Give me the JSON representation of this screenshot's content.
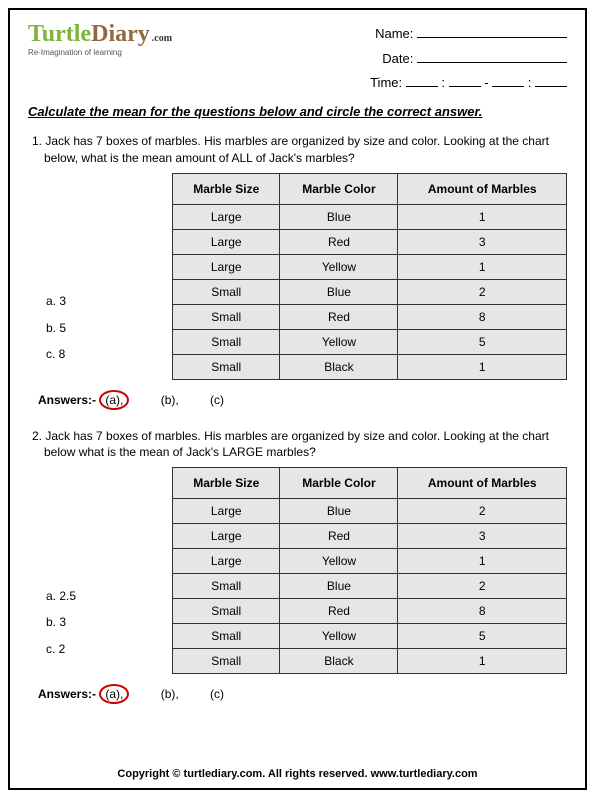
{
  "header": {
    "brand": "TurtleDiary",
    "dotcom": ".com",
    "tagline": "Re-Imagination of learning",
    "name_label": "Name:",
    "date_label": "Date:",
    "time_label": "Time:"
  },
  "instruction": "Calculate the mean for the questions below and circle the correct answer.",
  "q1": {
    "num": "1.",
    "text": "Jack has 7 boxes of marbles. His marbles are organized by size and color. Looking at the chart below, what is the mean amount of ALL of Jack's marbles?",
    "choices": {
      "a": "a. 3",
      "b": "b. 5",
      "c": "c. 8"
    },
    "headers": {
      "c1": "Marble Size",
      "c2": "Marble Color",
      "c3": "Amount of Marbles"
    },
    "rows": [
      {
        "s": "Large",
        "c": "Blue",
        "a": "1"
      },
      {
        "s": "Large",
        "c": "Red",
        "a": "3"
      },
      {
        "s": "Large",
        "c": "Yellow",
        "a": "1"
      },
      {
        "s": "Small",
        "c": "Blue",
        "a": "2"
      },
      {
        "s": "Small",
        "c": "Red",
        "a": "8"
      },
      {
        "s": "Small",
        "c": "Yellow",
        "a": "5"
      },
      {
        "s": "Small",
        "c": "Black",
        "a": "1"
      }
    ]
  },
  "q2": {
    "num": "2.",
    "text": "Jack has 7 boxes of marbles. His marbles are organized by size and color. Looking at the chart below what is the mean of Jack's LARGE marbles?",
    "choices": {
      "a": "a. 2.5",
      "b": "b. 3",
      "c": "c. 2"
    },
    "headers": {
      "c1": "Marble Size",
      "c2": "Marble Color",
      "c3": "Amount of Marbles"
    },
    "rows": [
      {
        "s": "Large",
        "c": "Blue",
        "a": "2"
      },
      {
        "s": "Large",
        "c": "Red",
        "a": "3"
      },
      {
        "s": "Large",
        "c": "Yellow",
        "a": "1"
      },
      {
        "s": "Small",
        "c": "Blue",
        "a": "2"
      },
      {
        "s": "Small",
        "c": "Red",
        "a": "8"
      },
      {
        "s": "Small",
        "c": "Yellow",
        "a": "5"
      },
      {
        "s": "Small",
        "c": "Black",
        "a": "1"
      }
    ]
  },
  "answers": {
    "label": "Answers:-",
    "a": "(a),",
    "b": "(b),",
    "c": "(c)"
  },
  "footer": "Copyright © turtlediary.com. All rights reserved. www.turtlediary.com"
}
